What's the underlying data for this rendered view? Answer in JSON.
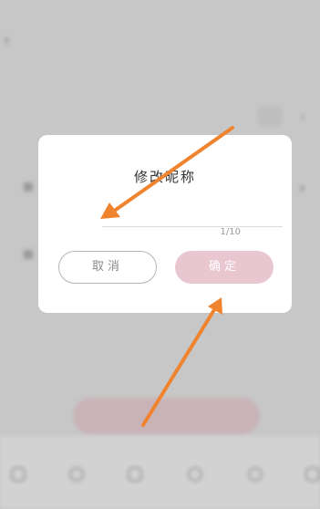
{
  "background": {
    "back_icon": "back-chevron-icon",
    "row_chevron": "›",
    "row_label": ""
  },
  "dialog": {
    "title": "修改昵称",
    "input_value": "",
    "input_placeholder": "",
    "counter": "1/10",
    "cancel_label": "取消",
    "confirm_label": "确定"
  },
  "colors": {
    "overlay": "#c7c7c7",
    "confirm_button": "#e9c7d0",
    "annotation_arrow": "#f0832e"
  }
}
